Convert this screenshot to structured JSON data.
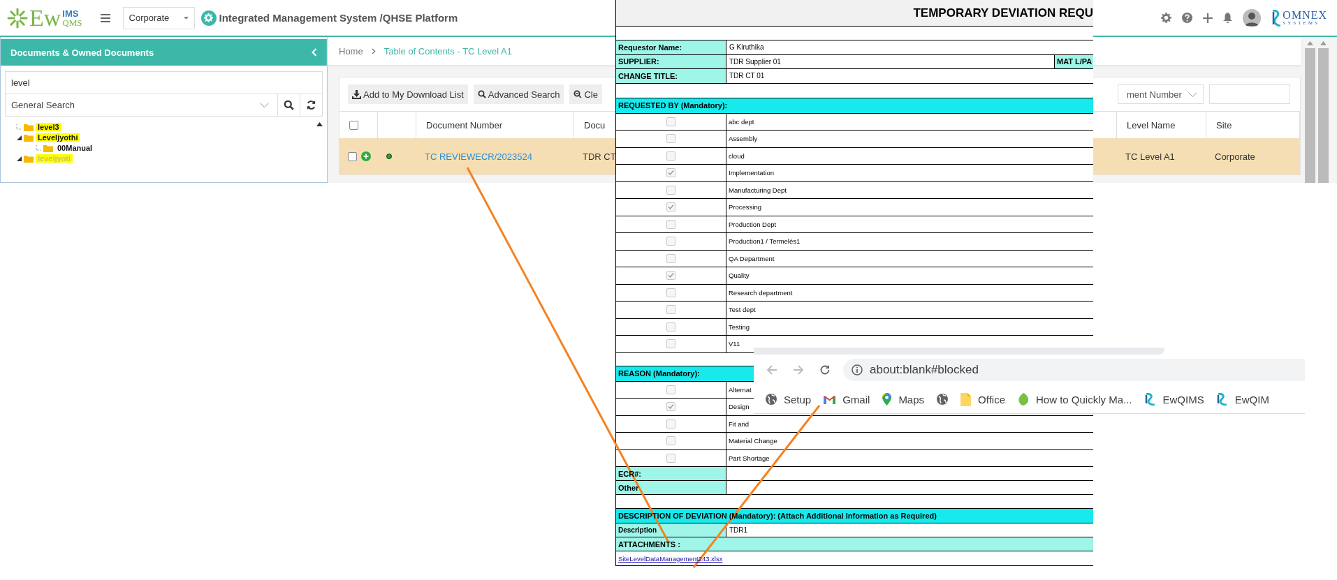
{
  "app": {
    "logo": {
      "main": "Ew",
      "top": "IMS",
      "bottom": "QMS"
    },
    "site_select": "Corporate",
    "title": "Integrated Management System /QHSE Platform",
    "brand": {
      "name": "OMNEX",
      "tagline": "SYSTEMS"
    }
  },
  "sidebar": {
    "title": "Documents & Owned Documents",
    "search_value": "level",
    "search_type": "General Search",
    "tree": [
      {
        "label": "level3",
        "highlighted": true,
        "selected": false,
        "expanded": false
      },
      {
        "label": "Leveljyothi",
        "highlighted": true,
        "selected": false,
        "expanded": true,
        "children": [
          {
            "label": "00Manual",
            "highlighted": false,
            "selected": false,
            "expanded": false
          }
        ]
      },
      {
        "label": "leveljyoti",
        "highlighted": true,
        "selected": true,
        "expanded": true
      }
    ]
  },
  "breadcrumb": [
    "Home",
    "Table of Contents - TC Level A1"
  ],
  "toolbar": {
    "buttons": [
      {
        "label": "Add to My Download List",
        "kind": "download"
      },
      {
        "label": "Advanced Search",
        "kind": "search"
      },
      {
        "label": "Cle",
        "kind": "clear"
      }
    ],
    "search_by": "ment Number"
  },
  "table": {
    "header_checked": false,
    "columns_left": [
      "Document Number",
      "Docu"
    ],
    "columns_right": [
      "Level Name",
      "Site"
    ],
    "rows": [
      {
        "checked": false,
        "highlighted": true,
        "color": "#22aa22",
        "document_number": "TC REVIEWECR/2023524",
        "column_2": "TDR CT",
        "level_name": "TC Level A1",
        "site": "Corporate"
      }
    ]
  },
  "form": {
    "title": "TEMPORARY DEVIATION REQU",
    "fields": [
      {
        "label": "Requestor Name:",
        "value": "G Kiruthika"
      },
      {
        "label": "SUPPLIER:",
        "value": "TDR Supplier 01",
        "extra_label": "MAT L/PA"
      },
      {
        "label": "CHANGE TITLE:",
        "value": "TDR CT 01"
      }
    ],
    "requested_by": {
      "heading": "REQUESTED BY (Mandatory):",
      "options": [
        {
          "label": "abc dept",
          "checked": false
        },
        {
          "label": "Assembly",
          "checked": false
        },
        {
          "label": "cloud",
          "checked": false
        },
        {
          "label": "Implementation",
          "checked": true
        },
        {
          "label": "Manufacturing Dept",
          "checked": false
        },
        {
          "label": "Processing",
          "checked": true
        },
        {
          "label": "Production Dept",
          "checked": false
        },
        {
          "label": "Production1 / Termelés1",
          "checked": false
        },
        {
          "label": "QA Department",
          "checked": false
        },
        {
          "label": "Quality",
          "checked": true
        },
        {
          "label": "Research department",
          "checked": false
        },
        {
          "label": "Test dept",
          "checked": false
        },
        {
          "label": "Testing",
          "checked": false
        },
        {
          "label": "V11",
          "checked": false
        }
      ]
    },
    "reason": {
      "heading": "REASON (Mandatory):",
      "options": [
        {
          "label": "Alternat",
          "checked": false
        },
        {
          "label": "Design",
          "checked": true
        },
        {
          "label": "Fit and",
          "checked": false
        },
        {
          "label": "Material Change",
          "checked": false
        },
        {
          "label": "Part Shortage",
          "checked": false
        }
      ]
    },
    "extra_fields": [
      {
        "label": "ECR#:"
      },
      {
        "label": "Other"
      }
    ],
    "deviation": {
      "heading": "DESCRIPTION OF DEVIATION (Mandatory): (Attach Additional Information as Required)",
      "description_label": "Description",
      "description_value": "TDR1",
      "attachments_label": "ATTACHMENTS :",
      "attachment_link": "SiteLevelDataManagement243.xlsx"
    }
  },
  "browser": {
    "address": "about:blank#blocked",
    "bookmarks": [
      {
        "kind": "globe",
        "label": "Setup"
      },
      {
        "kind": "gmail",
        "label": "Gmail"
      },
      {
        "kind": "maps",
        "label": "Maps"
      },
      {
        "kind": "globe"
      },
      {
        "kind": "folder",
        "label": "Office"
      },
      {
        "kind": "leaf",
        "label": "How to Quickly Ma..."
      },
      {
        "kind": "ewqims",
        "label": "EwQIMS"
      },
      {
        "kind": "ewqims",
        "label": "EwQIM"
      }
    ]
  }
}
